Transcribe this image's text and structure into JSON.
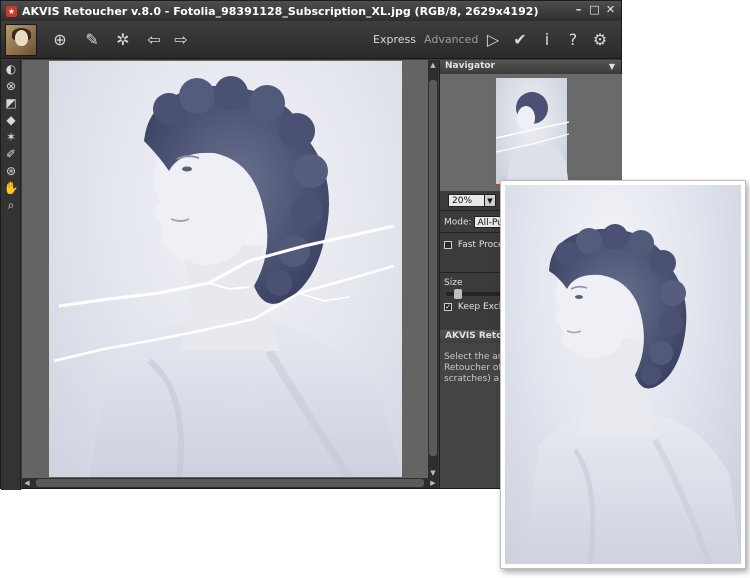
{
  "window": {
    "title": "AKVIS Retoucher v.8.0 - Fotolia_98391128_Subscription_XL.jpg (RGB/8, 2629x4192)",
    "controls": [
      "–",
      "□",
      "✕"
    ]
  },
  "toolbar": {
    "icons": [
      "open-icon",
      "save-icon",
      "share-icon",
      "settings-gear-icon",
      "back-arrow-icon",
      "forward-arrow-icon",
      "run-icon",
      "apply-icon",
      "info-icon",
      "help-icon",
      "preferences-icon"
    ],
    "mode_express": "Express",
    "mode_advanced": "Advanced",
    "active_mode": "Express"
  },
  "navigator": {
    "title": "Navigator",
    "zoom": "20%"
  },
  "settings": {
    "mode_label": "Mode:",
    "mode_value": "All-Purp",
    "fast_processing": "Fast Processi",
    "size_label": "Size",
    "keep_exclusion": "Keep Exclusi",
    "keep_exclusion_checked": true,
    "fast_processing_checked": false
  },
  "help": {
    "title": "AKVIS Retouc",
    "text": "Select the areas retouched and t Retoucher offer photographs: re and scratches) a"
  },
  "colors": {
    "accent": "#d23a3a",
    "panel_bg": "#3b3b3b",
    "toolbar_bg": "#2a2a2a"
  }
}
